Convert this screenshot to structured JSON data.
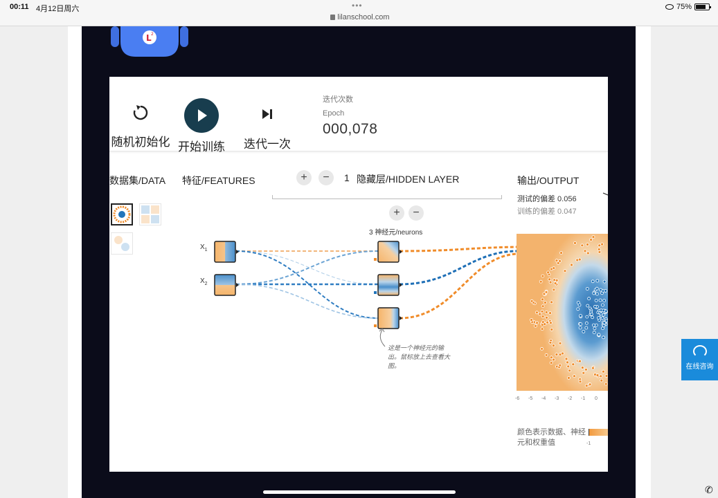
{
  "status_bar": {
    "time": "00:11",
    "date": "4月12日周六",
    "url": "lilanschool.com",
    "battery": "75%",
    "battery_level": 0.75
  },
  "mascot": {
    "badge": "L²"
  },
  "controls": {
    "reset_label": "随机初始化",
    "play_label": "开始训练",
    "step_label": "迭代一次",
    "epoch_caption_cn": "迭代次数",
    "epoch_caption_en": "Epoch",
    "epoch_value": "000,078"
  },
  "columns": {
    "data": "数据集/DATA",
    "features": "特征/FEATURES",
    "hidden_count": "1",
    "hidden": "隐藏层/HIDDEN LAYER",
    "output": "输出/OUTPUT"
  },
  "buttons": {
    "plus": "+",
    "minus": "−"
  },
  "layer": {
    "neurons_label": "3 神经元/neurons"
  },
  "features": [
    {
      "name": "X",
      "sub": "1"
    },
    {
      "name": "X",
      "sub": "2"
    }
  ],
  "output": {
    "test_loss": "测试的偏差 0.056",
    "train_loss": "训练的偏差 0.047",
    "axis_ticks": [
      "-6",
      "-5",
      "-4",
      "-3",
      "-2",
      "-1",
      "0"
    ]
  },
  "annotation": "这是一个神经元的输出。鼠标放上去查看大图。",
  "legend": {
    "text": "颜色表示数据、神经元和权重值",
    "tick": "-1"
  },
  "colors": {
    "orange": "#f08c2a",
    "blue": "#2275bb",
    "navy": "#183d4e",
    "consult": "#1a8bdb"
  },
  "consult": {
    "label": "在线咨询"
  }
}
